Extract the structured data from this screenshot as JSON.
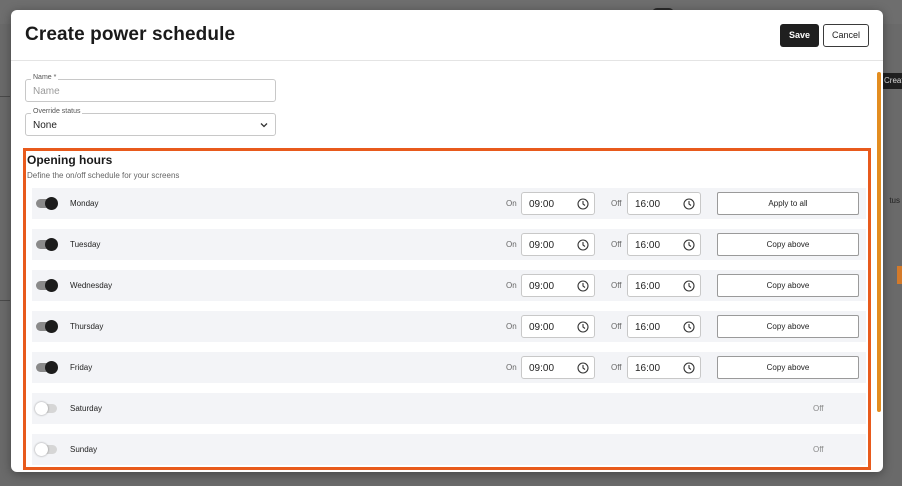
{
  "background": {
    "create_label": "Creat",
    "status_fragment": "tus"
  },
  "modal": {
    "title": "Create power schedule",
    "save_label": "Save",
    "cancel_label": "Cancel"
  },
  "form": {
    "name": {
      "label": "Name *",
      "placeholder": "Name"
    },
    "override": {
      "label": "Override status",
      "value": "None"
    }
  },
  "opening_hours": {
    "title": "Opening hours",
    "subtitle": "Define the on/off schedule for your screens",
    "on_label": "On",
    "off_label": "Off",
    "days": [
      {
        "name": "Monday",
        "enabled": true,
        "on": "09:00",
        "off": "16:00",
        "action": "Apply to all"
      },
      {
        "name": "Tuesday",
        "enabled": true,
        "on": "09:00",
        "off": "16:00",
        "action": "Copy above"
      },
      {
        "name": "Wednesday",
        "enabled": true,
        "on": "09:00",
        "off": "16:00",
        "action": "Copy above"
      },
      {
        "name": "Thursday",
        "enabled": true,
        "on": "09:00",
        "off": "16:00",
        "action": "Copy above"
      },
      {
        "name": "Friday",
        "enabled": true,
        "on": "09:00",
        "off": "16:00",
        "action": "Copy above"
      },
      {
        "name": "Saturday",
        "enabled": false,
        "status": "Off"
      },
      {
        "name": "Sunday",
        "enabled": false,
        "status": "Off"
      }
    ]
  },
  "colors": {
    "highlight": "#e85a1c",
    "scrollbar": "#e38d20",
    "primary": "#1f1f1f"
  }
}
